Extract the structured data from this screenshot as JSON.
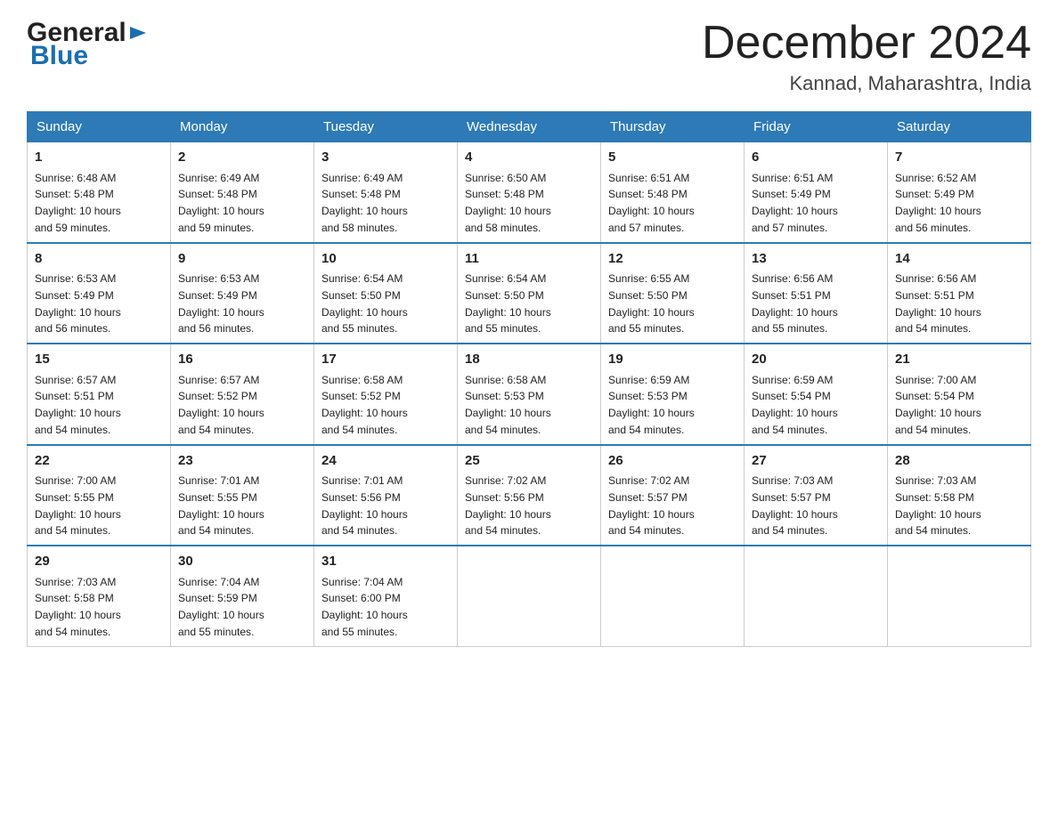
{
  "header": {
    "logo_general": "General",
    "logo_blue": "Blue",
    "title": "December 2024",
    "location": "Kannad, Maharashtra, India"
  },
  "weekdays": [
    "Sunday",
    "Monday",
    "Tuesday",
    "Wednesday",
    "Thursday",
    "Friday",
    "Saturday"
  ],
  "weeks": [
    {
      "days": [
        {
          "num": "1",
          "sunrise": "6:48 AM",
          "sunset": "5:48 PM",
          "daylight": "10 hours and 59 minutes."
        },
        {
          "num": "2",
          "sunrise": "6:49 AM",
          "sunset": "5:48 PM",
          "daylight": "10 hours and 59 minutes."
        },
        {
          "num": "3",
          "sunrise": "6:49 AM",
          "sunset": "5:48 PM",
          "daylight": "10 hours and 58 minutes."
        },
        {
          "num": "4",
          "sunrise": "6:50 AM",
          "sunset": "5:48 PM",
          "daylight": "10 hours and 58 minutes."
        },
        {
          "num": "5",
          "sunrise": "6:51 AM",
          "sunset": "5:48 PM",
          "daylight": "10 hours and 57 minutes."
        },
        {
          "num": "6",
          "sunrise": "6:51 AM",
          "sunset": "5:49 PM",
          "daylight": "10 hours and 57 minutes."
        },
        {
          "num": "7",
          "sunrise": "6:52 AM",
          "sunset": "5:49 PM",
          "daylight": "10 hours and 56 minutes."
        }
      ]
    },
    {
      "days": [
        {
          "num": "8",
          "sunrise": "6:53 AM",
          "sunset": "5:49 PM",
          "daylight": "10 hours and 56 minutes."
        },
        {
          "num": "9",
          "sunrise": "6:53 AM",
          "sunset": "5:49 PM",
          "daylight": "10 hours and 56 minutes."
        },
        {
          "num": "10",
          "sunrise": "6:54 AM",
          "sunset": "5:50 PM",
          "daylight": "10 hours and 55 minutes."
        },
        {
          "num": "11",
          "sunrise": "6:54 AM",
          "sunset": "5:50 PM",
          "daylight": "10 hours and 55 minutes."
        },
        {
          "num": "12",
          "sunrise": "6:55 AM",
          "sunset": "5:50 PM",
          "daylight": "10 hours and 55 minutes."
        },
        {
          "num": "13",
          "sunrise": "6:56 AM",
          "sunset": "5:51 PM",
          "daylight": "10 hours and 55 minutes."
        },
        {
          "num": "14",
          "sunrise": "6:56 AM",
          "sunset": "5:51 PM",
          "daylight": "10 hours and 54 minutes."
        }
      ]
    },
    {
      "days": [
        {
          "num": "15",
          "sunrise": "6:57 AM",
          "sunset": "5:51 PM",
          "daylight": "10 hours and 54 minutes."
        },
        {
          "num": "16",
          "sunrise": "6:57 AM",
          "sunset": "5:52 PM",
          "daylight": "10 hours and 54 minutes."
        },
        {
          "num": "17",
          "sunrise": "6:58 AM",
          "sunset": "5:52 PM",
          "daylight": "10 hours and 54 minutes."
        },
        {
          "num": "18",
          "sunrise": "6:58 AM",
          "sunset": "5:53 PM",
          "daylight": "10 hours and 54 minutes."
        },
        {
          "num": "19",
          "sunrise": "6:59 AM",
          "sunset": "5:53 PM",
          "daylight": "10 hours and 54 minutes."
        },
        {
          "num": "20",
          "sunrise": "6:59 AM",
          "sunset": "5:54 PM",
          "daylight": "10 hours and 54 minutes."
        },
        {
          "num": "21",
          "sunrise": "7:00 AM",
          "sunset": "5:54 PM",
          "daylight": "10 hours and 54 minutes."
        }
      ]
    },
    {
      "days": [
        {
          "num": "22",
          "sunrise": "7:00 AM",
          "sunset": "5:55 PM",
          "daylight": "10 hours and 54 minutes."
        },
        {
          "num": "23",
          "sunrise": "7:01 AM",
          "sunset": "5:55 PM",
          "daylight": "10 hours and 54 minutes."
        },
        {
          "num": "24",
          "sunrise": "7:01 AM",
          "sunset": "5:56 PM",
          "daylight": "10 hours and 54 minutes."
        },
        {
          "num": "25",
          "sunrise": "7:02 AM",
          "sunset": "5:56 PM",
          "daylight": "10 hours and 54 minutes."
        },
        {
          "num": "26",
          "sunrise": "7:02 AM",
          "sunset": "5:57 PM",
          "daylight": "10 hours and 54 minutes."
        },
        {
          "num": "27",
          "sunrise": "7:03 AM",
          "sunset": "5:57 PM",
          "daylight": "10 hours and 54 minutes."
        },
        {
          "num": "28",
          "sunrise": "7:03 AM",
          "sunset": "5:58 PM",
          "daylight": "10 hours and 54 minutes."
        }
      ]
    },
    {
      "days": [
        {
          "num": "29",
          "sunrise": "7:03 AM",
          "sunset": "5:58 PM",
          "daylight": "10 hours and 54 minutes."
        },
        {
          "num": "30",
          "sunrise": "7:04 AM",
          "sunset": "5:59 PM",
          "daylight": "10 hours and 55 minutes."
        },
        {
          "num": "31",
          "sunrise": "7:04 AM",
          "sunset": "6:00 PM",
          "daylight": "10 hours and 55 minutes."
        },
        null,
        null,
        null,
        null
      ]
    }
  ],
  "labels": {
    "sunrise": "Sunrise:",
    "sunset": "Sunset:",
    "daylight": "Daylight:"
  }
}
